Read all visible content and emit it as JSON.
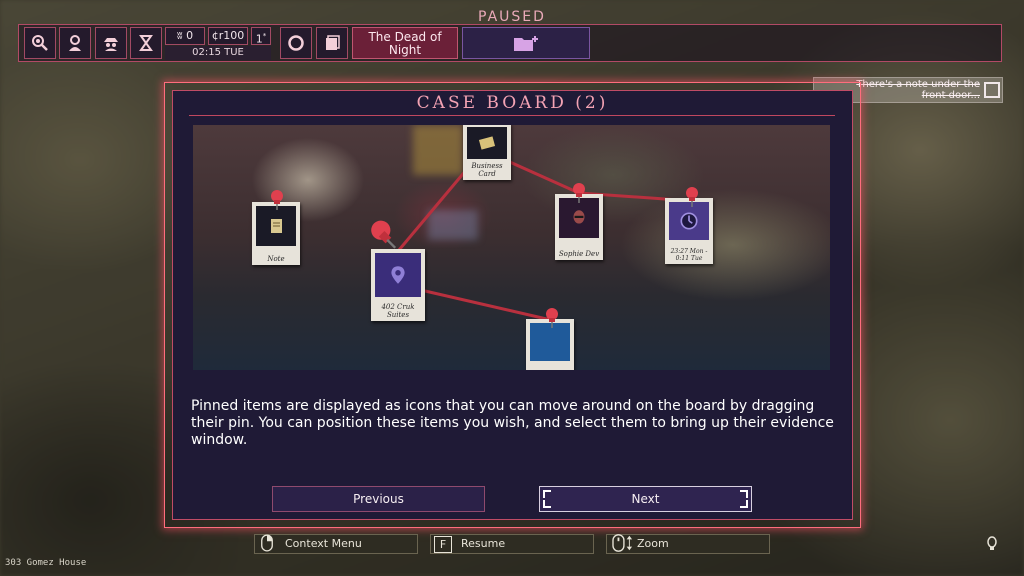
{
  "hud": {
    "paused_label": "PAUSED",
    "resources": {
      "food": "0",
      "credits": "¢r100",
      "stars": "1"
    },
    "time": "02:15 TUE",
    "objective": "The Dead of Night",
    "buttons": [
      "search-icon",
      "person-pin-icon",
      "detective-icon",
      "hourglass-icon",
      "ring-icon",
      "notes-icon"
    ]
  },
  "note_toast": {
    "text": "There's a note under the front door..."
  },
  "case_board": {
    "title": "CASE BOARD (2)",
    "items": [
      {
        "caption": "Note",
        "icon": "note-icon"
      },
      {
        "caption": "Business Card",
        "icon": "business-card-icon"
      },
      {
        "caption": "402 Cruk Suites",
        "icon": "location-pin-icon"
      },
      {
        "caption": "Sophie Dev",
        "icon": "portrait-icon"
      },
      {
        "caption": "23:27 Mon - 0:11 Tue",
        "icon": "clock-icon"
      },
      {
        "caption": "",
        "icon": "evidence-photo-icon"
      }
    ],
    "description": "Pinned items are displayed as icons that you can move around on the board by dragging their pin. You can position these items you wish, and select them to bring up their evidence window.",
    "previous_label": "Previous",
    "next_label": "Next"
  },
  "hints": {
    "context_menu": "Context Menu",
    "resume_key": "F",
    "resume": "Resume",
    "zoom": "Zoom"
  },
  "location": "303 Gomez House",
  "colors": {
    "accent": "#c04c66",
    "panel": "#1f1a36",
    "objective": "#6b2038"
  }
}
